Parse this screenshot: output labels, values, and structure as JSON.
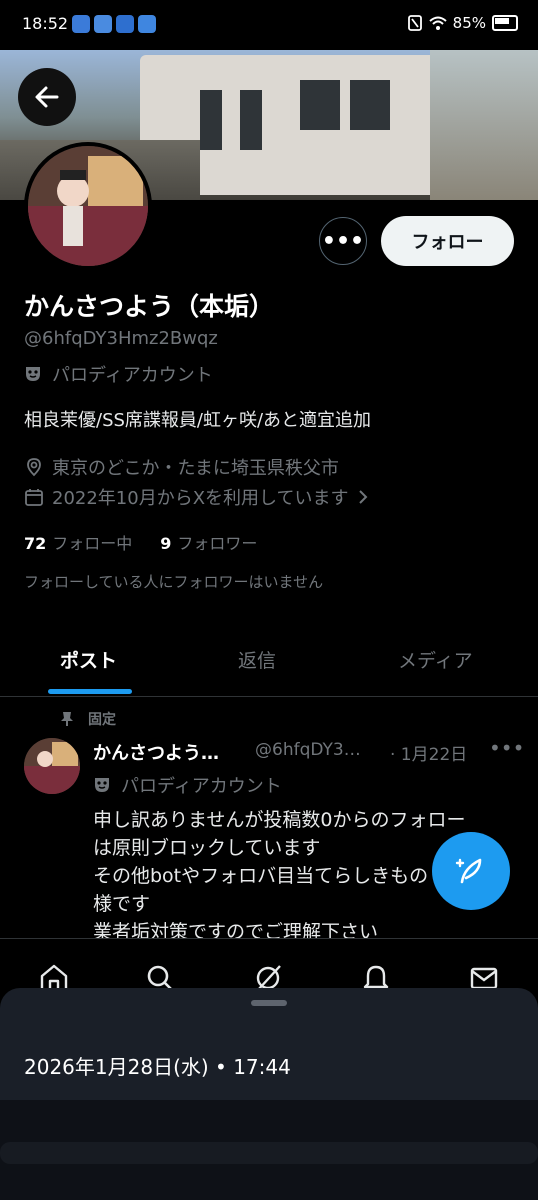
{
  "status_bar": {
    "time": "18:52",
    "battery": "85%"
  },
  "profile": {
    "name": "かんさつよう（本垢）",
    "handle": "@6hfqDY3Hmz2Bwqz",
    "label": "パロディアカウント",
    "bio": "相良茉優/SS席諜報員/虹ヶ咲/あと適宜追加",
    "location": "東京のどこか・たまに埼玉県秩父市",
    "joined": "2022年10月からXを利用しています",
    "following_count": "72",
    "following_label": "フォロー中",
    "followers_count": "9",
    "followers_label": "フォロワー",
    "followed_by_note": "フォローしている人にフォロワーはいません",
    "follow_button": "フォロー",
    "more_button": "•••"
  },
  "tabs": [
    {
      "label": "ポスト",
      "active": true
    },
    {
      "label": "返信",
      "active": false
    },
    {
      "label": "メディア",
      "active": false
    }
  ],
  "pinned_post": {
    "pinned_label": "固定",
    "name": "かんさつよう…",
    "handle": "@6hfqDY3…",
    "date": "· 1月22日",
    "label": "パロディアカウント",
    "text": "申し訳ありませんが投稿数0からのフォロー\nは原則ブロックしています\nその他botやフォロバ目当てらしきもの\n様です\n業者垢対策ですのでご理解下さい"
  },
  "bottom_nav": [
    "home-icon",
    "search-icon",
    "grok-icon",
    "notifications-icon",
    "messages-icon"
  ],
  "notification_sheet": {
    "datetime": "2026年1月28日(水) • 17:44"
  },
  "colors": {
    "accent": "#1d9bf0",
    "background": "#000000",
    "muted_text": "#71767b"
  }
}
